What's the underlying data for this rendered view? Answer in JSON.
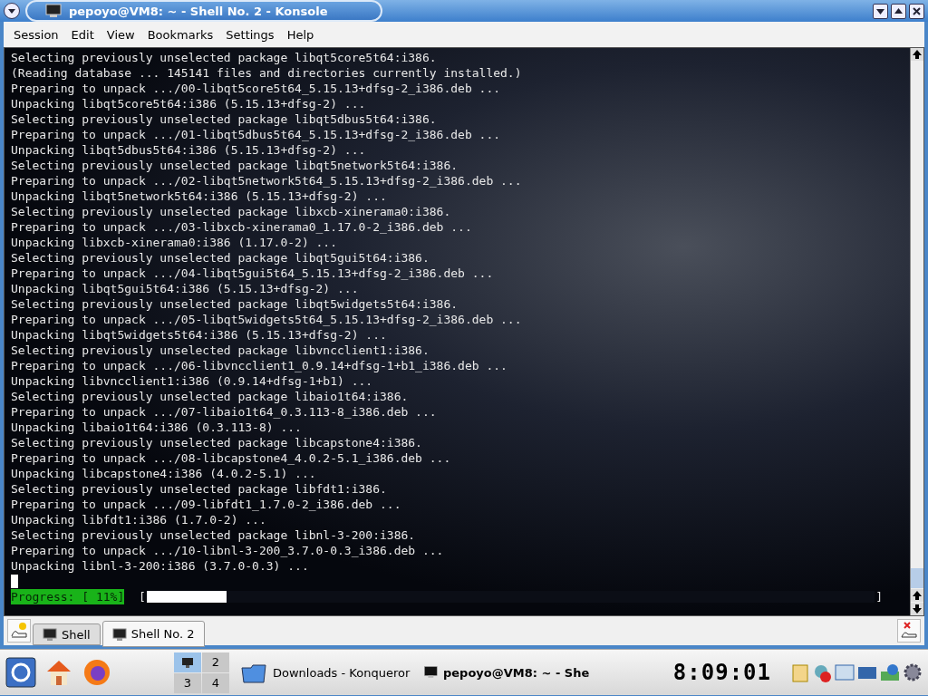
{
  "window": {
    "title": "pepoyo@VM8: ~ - Shell No. 2 - Konsole"
  },
  "menu": [
    "Session",
    "Edit",
    "View",
    "Bookmarks",
    "Settings",
    "Help"
  ],
  "terminal": {
    "lines": [
      "Selecting previously unselected package libqt5core5t64:i386.",
      "(Reading database ... 145141 files and directories currently installed.)",
      "Preparing to unpack .../00-libqt5core5t64_5.15.13+dfsg-2_i386.deb ...",
      "Unpacking libqt5core5t64:i386 (5.15.13+dfsg-2) ...",
      "Selecting previously unselected package libqt5dbus5t64:i386.",
      "Preparing to unpack .../01-libqt5dbus5t64_5.15.13+dfsg-2_i386.deb ...",
      "Unpacking libqt5dbus5t64:i386 (5.15.13+dfsg-2) ...",
      "Selecting previously unselected package libqt5network5t64:i386.",
      "Preparing to unpack .../02-libqt5network5t64_5.15.13+dfsg-2_i386.deb ...",
      "Unpacking libqt5network5t64:i386 (5.15.13+dfsg-2) ...",
      "Selecting previously unselected package libxcb-xinerama0:i386.",
      "Preparing to unpack .../03-libxcb-xinerama0_1.17.0-2_i386.deb ...",
      "Unpacking libxcb-xinerama0:i386 (1.17.0-2) ...",
      "Selecting previously unselected package libqt5gui5t64:i386.",
      "Preparing to unpack .../04-libqt5gui5t64_5.15.13+dfsg-2_i386.deb ...",
      "Unpacking libqt5gui5t64:i386 (5.15.13+dfsg-2) ...",
      "Selecting previously unselected package libqt5widgets5t64:i386.",
      "Preparing to unpack .../05-libqt5widgets5t64_5.15.13+dfsg-2_i386.deb ...",
      "Unpacking libqt5widgets5t64:i386 (5.15.13+dfsg-2) ...",
      "Selecting previously unselected package libvncclient1:i386.",
      "Preparing to unpack .../06-libvncclient1_0.9.14+dfsg-1+b1_i386.deb ...",
      "Unpacking libvncclient1:i386 (0.9.14+dfsg-1+b1) ...",
      "Selecting previously unselected package libaio1t64:i386.",
      "Preparing to unpack .../07-libaio1t64_0.3.113-8_i386.deb ...",
      "Unpacking libaio1t64:i386 (0.3.113-8) ...",
      "Selecting previously unselected package libcapstone4:i386.",
      "Preparing to unpack .../08-libcapstone4_4.0.2-5.1_i386.deb ...",
      "Unpacking libcapstone4:i386 (4.0.2-5.1) ...",
      "Selecting previously unselected package libfdt1:i386.",
      "Preparing to unpack .../09-libfdt1_1.7.0-2_i386.deb ...",
      "Unpacking libfdt1:i386 (1.7.0-2) ...",
      "Selecting previously unselected package libnl-3-200:i386.",
      "Preparing to unpack .../10-libnl-3-200_3.7.0-0.3_i386.deb ...",
      "Unpacking libnl-3-200:i386 (3.7.0-0.3) ..."
    ],
    "progress": {
      "label": "Progress: [ 11%]",
      "open_bracket": "[",
      "close_bracket": "]",
      "level": 0.11
    }
  },
  "tabs": [
    {
      "label": "Shell",
      "selected": false
    },
    {
      "label": "Shell No. 2",
      "selected": true
    }
  ],
  "taskbar": {
    "desktops": [
      {
        "selected": true
      },
      {
        "label": "2",
        "selected": false
      },
      {
        "label": "3",
        "selected": false
      },
      {
        "label": "4",
        "selected": false
      }
    ],
    "tasks": [
      {
        "label": "Downloads - Konqueror",
        "kind": "folder"
      },
      {
        "label": "pepoyo@VM8: ~ - She",
        "kind": "terminal"
      }
    ],
    "clock": "8:09:01"
  }
}
